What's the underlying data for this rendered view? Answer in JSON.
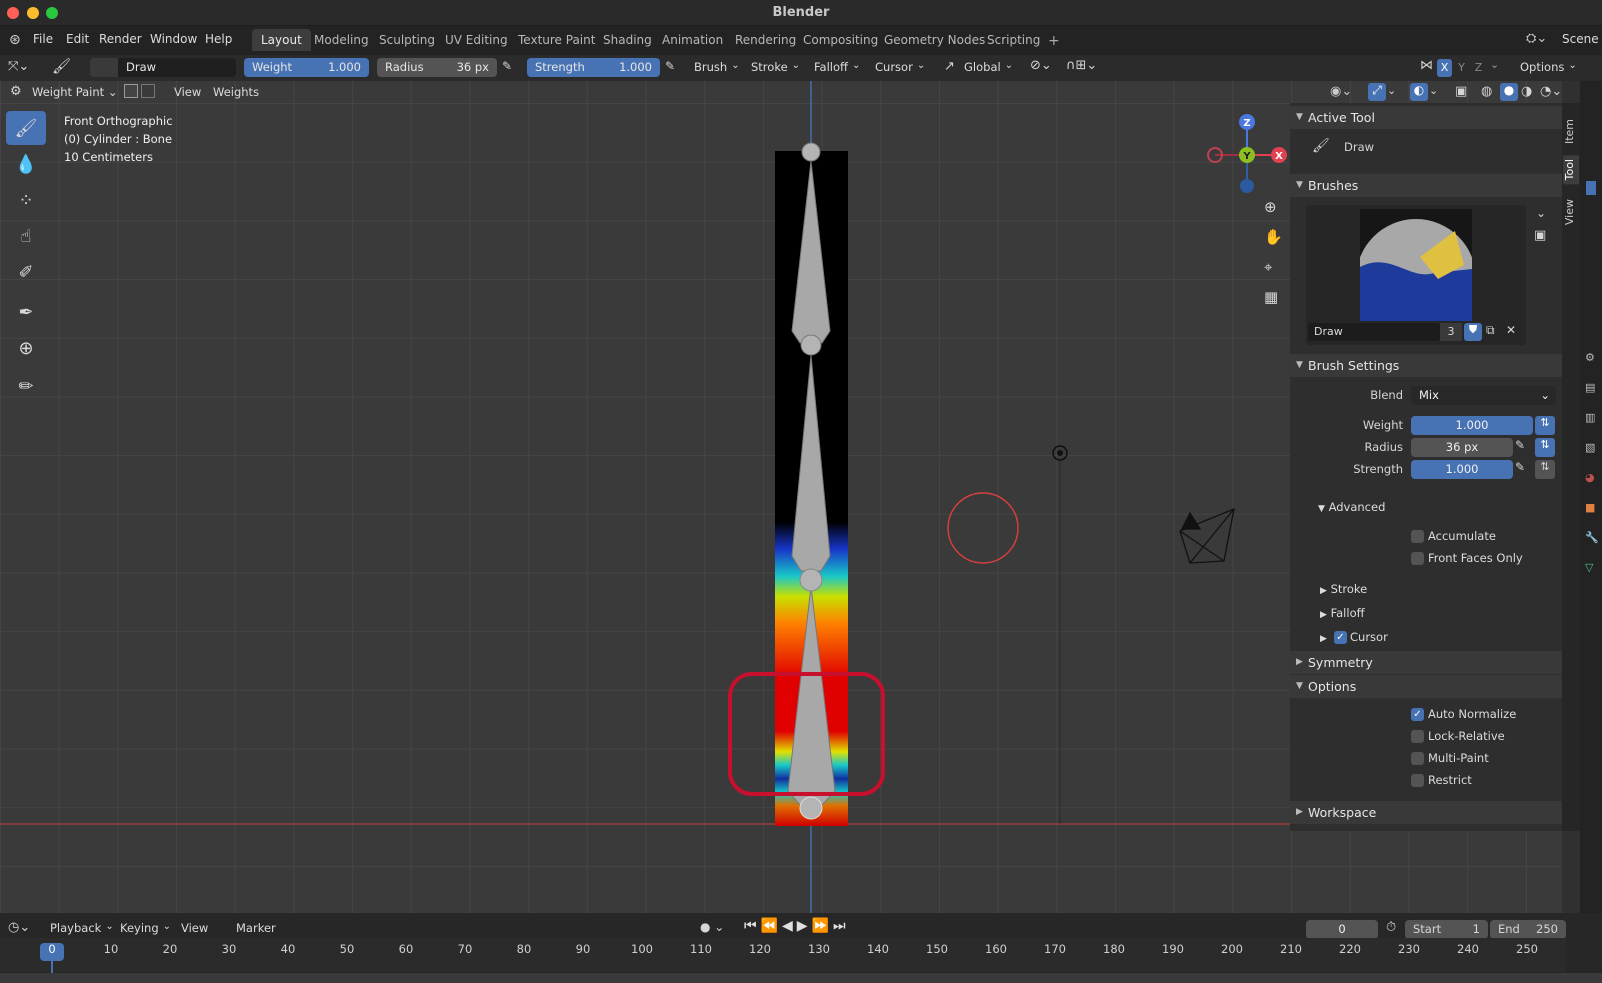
{
  "window": {
    "title": "Blender",
    "top_right_scene": "Scene"
  },
  "menu": [
    "File",
    "Edit",
    "Render",
    "Window",
    "Help"
  ],
  "workspaces": [
    "Layout",
    "Modeling",
    "Sculpting",
    "UV Editing",
    "Texture Paint",
    "Shading",
    "Animation",
    "Rendering",
    "Compositing",
    "Geometry Nodes",
    "Scripting"
  ],
  "workspace_active": "Layout",
  "tool_header": {
    "brush_name": "Draw",
    "weight_label": "Weight",
    "weight_value": "1.000",
    "radius_label": "Radius",
    "radius_value": "36 px",
    "strength_label": "Strength",
    "strength_value": "1.000",
    "menus": [
      "Brush",
      "Stroke",
      "Falloff",
      "Cursor"
    ],
    "orientation": "Global",
    "axes": [
      "X",
      "Y",
      "Z"
    ],
    "options": "Options"
  },
  "viewport_header": {
    "mode": "Weight Paint",
    "menus": [
      "View",
      "Weights"
    ]
  },
  "overlay": {
    "line1": "Front Orthographic",
    "line2": "(0) Cylinder : Bone",
    "line3": "10 Centimeters"
  },
  "gizmo": {
    "z": "Z",
    "y": "Y",
    "x": "X"
  },
  "npanel": {
    "tabs": [
      "Item",
      "Tool",
      "View"
    ],
    "active_tool_header": "Active Tool",
    "active_tool": "Draw",
    "brushes_header": "Brushes",
    "brush_name": "Draw",
    "brush_users": "3",
    "brush_settings_header": "Brush Settings",
    "blend_label": "Blend",
    "blend_value": "Mix",
    "weight_label": "Weight",
    "weight_value": "1.000",
    "radius_label": "Radius",
    "radius_value": "36 px",
    "strength_label": "Strength",
    "strength_value": "1.000",
    "advanced": "Advanced",
    "accumulate": "Accumulate",
    "front_faces": "Front Faces Only",
    "stroke": "Stroke",
    "falloff": "Falloff",
    "cursor": "Cursor",
    "symmetry": "Symmetry",
    "options": "Options",
    "auto_normalize": "Auto Normalize",
    "lock_relative": "Lock-Relative",
    "multi_paint": "Multi-Paint",
    "restrict": "Restrict",
    "workspace": "Workspace"
  },
  "timeline": {
    "menus": [
      "Playback",
      "Keying",
      "View",
      "Marker"
    ],
    "current_frame": "0",
    "start_label": "Start",
    "start": "1",
    "end_label": "End",
    "end": "250",
    "ticks": [
      "0",
      "10",
      "20",
      "30",
      "40",
      "50",
      "60",
      "70",
      "80",
      "90",
      "100",
      "110",
      "120",
      "130",
      "140",
      "150",
      "160",
      "170",
      "180",
      "190",
      "200",
      "210",
      "220",
      "230",
      "240",
      "250"
    ]
  },
  "colors": {
    "accent": "#4772b3",
    "highlight_box": "#c8102e",
    "brush_circle": "#d84040"
  }
}
